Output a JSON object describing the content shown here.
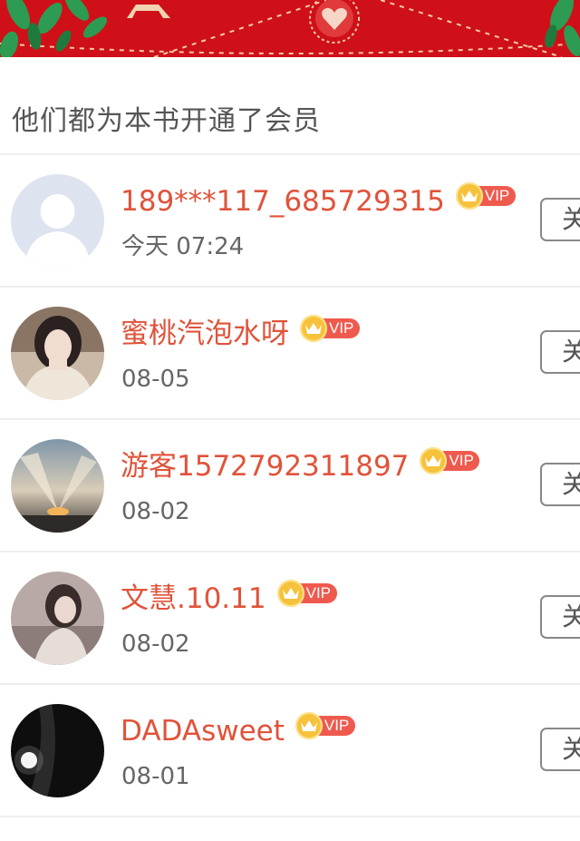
{
  "section": {
    "title": "他们都为本书开通了会员"
  },
  "colors": {
    "banner": "#cf1018",
    "name": "#e0533a",
    "vip_pill": "#ef5a4e",
    "crown": "#f7c23b"
  },
  "vip_badge_label": "VIP",
  "members": [
    {
      "name": "189***117_685729315",
      "time": "今天 07:24",
      "follow_label": "关",
      "avatar": "default-avatar"
    },
    {
      "name": "蜜桃汽泡水呀",
      "time": "08-05",
      "follow_label": "关",
      "avatar": "photo-avatar"
    },
    {
      "name": "游客1572792311897",
      "time": "08-02",
      "follow_label": "关",
      "avatar": "sky-photo-avatar"
    },
    {
      "name": "文慧.10.11",
      "time": "08-02",
      "follow_label": "关",
      "avatar": "photo-avatar"
    },
    {
      "name": "DADAsweet",
      "time": "08-01",
      "follow_label": "关",
      "avatar": "dark-photo-avatar"
    }
  ]
}
